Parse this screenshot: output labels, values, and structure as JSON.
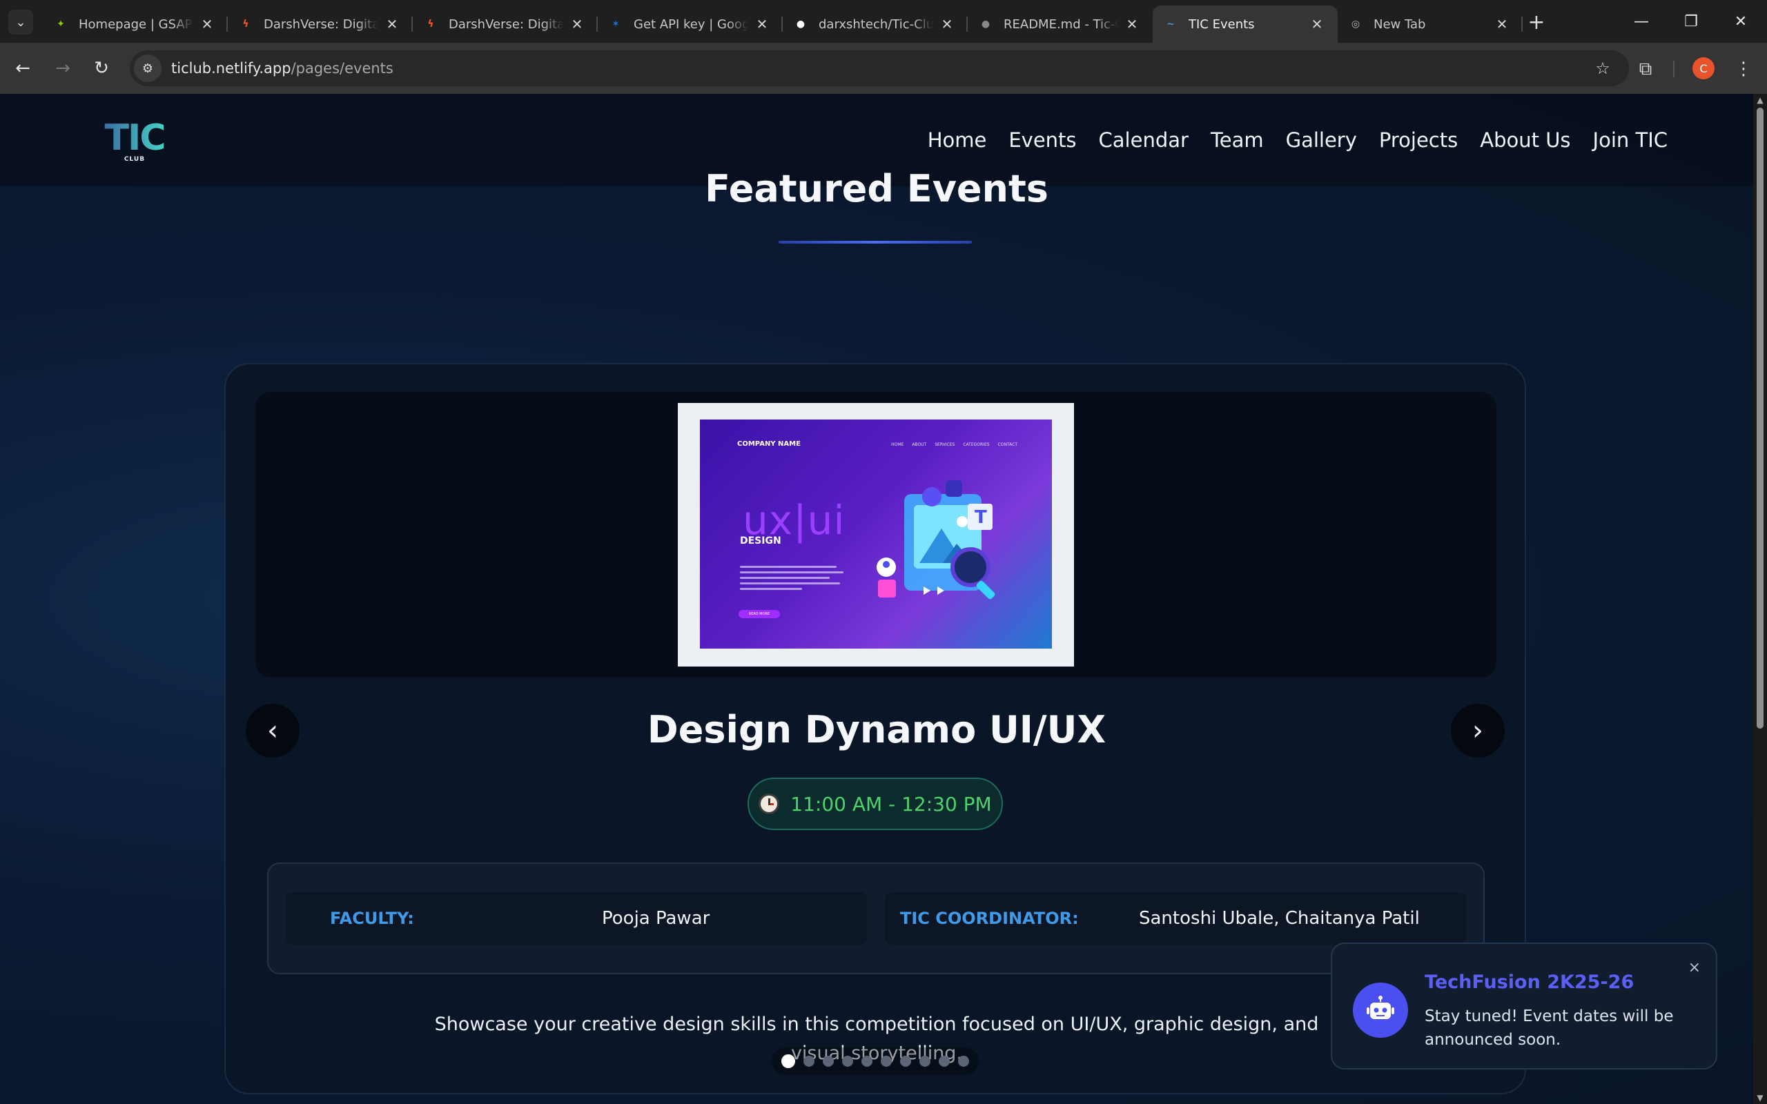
{
  "browser": {
    "tabs": [
      {
        "title": "Homepage | GSAP",
        "favicon": "gsap-icon",
        "color": "#88ce02"
      },
      {
        "title": "DarshVerse: Digital V",
        "favicon": "bolt-icon",
        "color": "#ff5722"
      },
      {
        "title": "DarshVerse: Digital V",
        "favicon": "bolt-icon",
        "color": "#ff5722"
      },
      {
        "title": "Get API key | Google",
        "favicon": "google-ai-icon",
        "color": "#1a73e8"
      },
      {
        "title": "darxshtech/Tic-Club",
        "favicon": "github-icon",
        "color": "#ffffff"
      },
      {
        "title": "README.md - Tic-Cl",
        "favicon": "github-icon",
        "color": "#888888"
      },
      {
        "title": "TIC Events",
        "favicon": "tic-icon",
        "color": "#4a90c8",
        "active": true
      },
      {
        "title": "New Tab",
        "favicon": "chrome-icon",
        "color": "#bbbbbb"
      }
    ],
    "url_host": "ticlub.netlify.app",
    "url_path": "/pages/events",
    "profile_initial": "C"
  },
  "site": {
    "logo_text": "TIC",
    "logo_sub": "CLUB",
    "nav": [
      "Home",
      "Events",
      "Calendar",
      "Team",
      "Gallery",
      "Projects",
      "About Us",
      "Join TIC"
    ]
  },
  "section": {
    "title": "Featured Events"
  },
  "poster": {
    "company": "COMPANY NAME",
    "nav": [
      "HOME",
      "ABOUT",
      "SERVICES",
      "CATEGORIES",
      "CONTACT"
    ],
    "headline": "ux|ui",
    "subline": "DESIGN",
    "button": "READ MORE"
  },
  "event": {
    "title": "Design Dynamo UI/UX",
    "time": "11:00 AM - 12:30 PM",
    "faculty_label": "FACULTY:",
    "faculty_value": "Pooja Pawar",
    "coordinator_label": "TIC COORDINATOR:",
    "coordinator_value": "Santoshi Ubale, Chaitanya Patil",
    "description": "Showcase your creative design skills in this competition focused on UI/UX, graphic design, and visual storytelling.",
    "slide_count": 10,
    "active_slide": 1
  },
  "toast": {
    "title": "TechFusion 2K25-26",
    "message": "Stay tuned! Event dates will be announced soon.",
    "close": "×"
  },
  "colors": {
    "accent": "#4c4ff0",
    "label_blue": "#3f9ae8",
    "time_green": "#4cd36a"
  }
}
